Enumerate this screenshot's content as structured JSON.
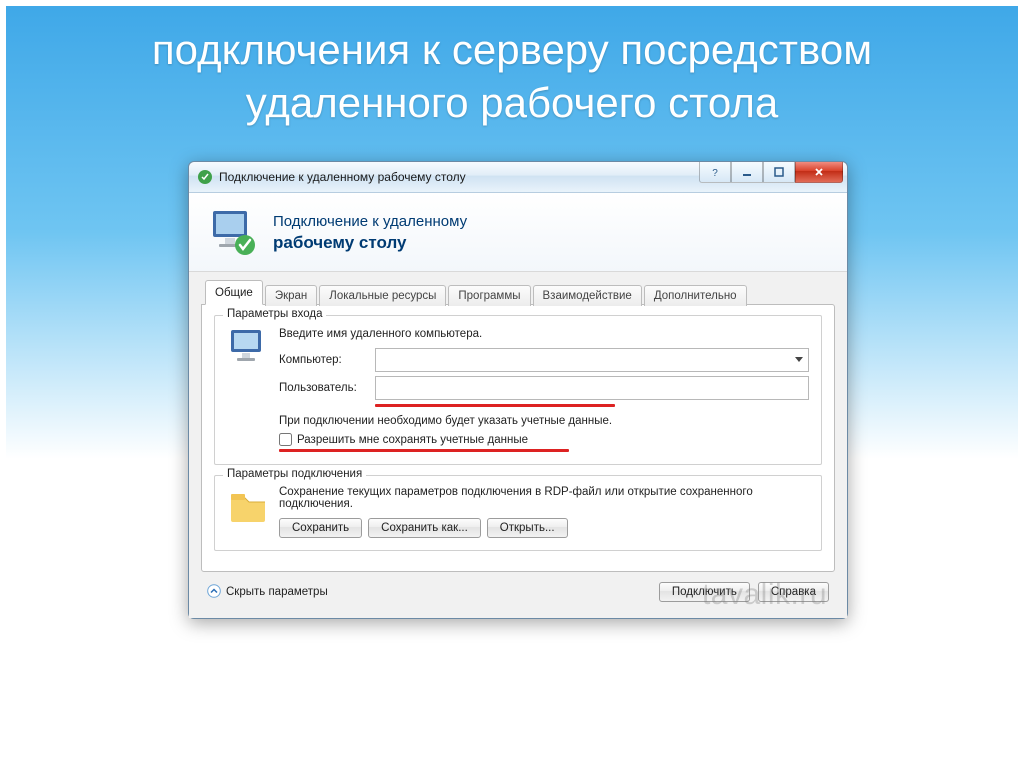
{
  "slide": {
    "title": "подключения к серверу посредством удаленного рабочего стола"
  },
  "window": {
    "title": "Подключение к удаленному рабочему столу",
    "header_line1": "Подключение к удаленному",
    "header_line2": "рабочему столу"
  },
  "tabs": [
    "Общие",
    "Экран",
    "Локальные ресурсы",
    "Программы",
    "Взаимодействие",
    "Дополнительно"
  ],
  "group_login": {
    "legend": "Параметры входа",
    "instruction": "Введите имя удаленного компьютера.",
    "computer_label": "Компьютер:",
    "computer_value": "",
    "user_label": "Пользователь:",
    "user_value": "",
    "note": "При подключении необходимо будет указать учетные данные.",
    "save_creds_label": "Разрешить мне сохранять учетные данные"
  },
  "group_conn": {
    "legend": "Параметры подключения",
    "text": "Сохранение текущих параметров подключения в RDP-файл или открытие сохраненного подключения.",
    "save": "Сохранить",
    "save_as": "Сохранить как...",
    "open": "Открыть..."
  },
  "footer": {
    "hide": "Скрыть параметры",
    "connect": "Подключить",
    "help": "Справка"
  },
  "watermark": "tavalik.ru"
}
